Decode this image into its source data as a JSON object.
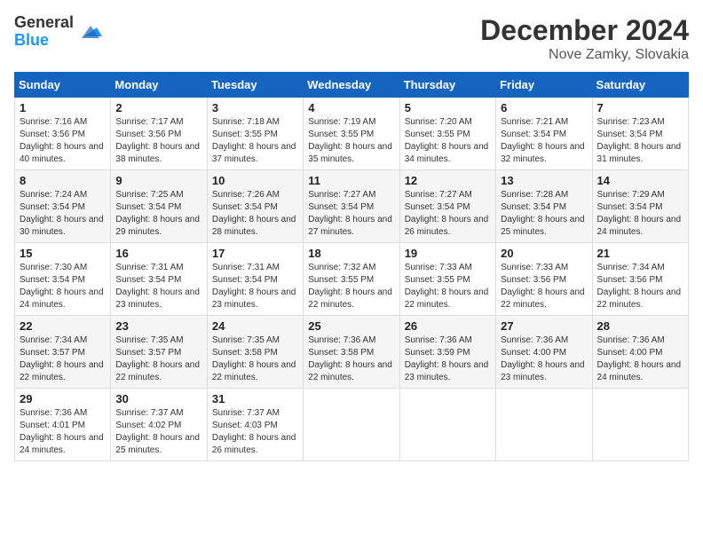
{
  "header": {
    "logo_general": "General",
    "logo_blue": "Blue",
    "month_year": "December 2024",
    "location": "Nove Zamky, Slovakia"
  },
  "days_of_week": [
    "Sunday",
    "Monday",
    "Tuesday",
    "Wednesday",
    "Thursday",
    "Friday",
    "Saturday"
  ],
  "weeks": [
    [
      {
        "day": "1",
        "sunrise": "Sunrise: 7:16 AM",
        "sunset": "Sunset: 3:56 PM",
        "daylight": "Daylight: 8 hours and 40 minutes."
      },
      {
        "day": "2",
        "sunrise": "Sunrise: 7:17 AM",
        "sunset": "Sunset: 3:56 PM",
        "daylight": "Daylight: 8 hours and 38 minutes."
      },
      {
        "day": "3",
        "sunrise": "Sunrise: 7:18 AM",
        "sunset": "Sunset: 3:55 PM",
        "daylight": "Daylight: 8 hours and 37 minutes."
      },
      {
        "day": "4",
        "sunrise": "Sunrise: 7:19 AM",
        "sunset": "Sunset: 3:55 PM",
        "daylight": "Daylight: 8 hours and 35 minutes."
      },
      {
        "day": "5",
        "sunrise": "Sunrise: 7:20 AM",
        "sunset": "Sunset: 3:55 PM",
        "daylight": "Daylight: 8 hours and 34 minutes."
      },
      {
        "day": "6",
        "sunrise": "Sunrise: 7:21 AM",
        "sunset": "Sunset: 3:54 PM",
        "daylight": "Daylight: 8 hours and 32 minutes."
      },
      {
        "day": "7",
        "sunrise": "Sunrise: 7:23 AM",
        "sunset": "Sunset: 3:54 PM",
        "daylight": "Daylight: 8 hours and 31 minutes."
      }
    ],
    [
      {
        "day": "8",
        "sunrise": "Sunrise: 7:24 AM",
        "sunset": "Sunset: 3:54 PM",
        "daylight": "Daylight: 8 hours and 30 minutes."
      },
      {
        "day": "9",
        "sunrise": "Sunrise: 7:25 AM",
        "sunset": "Sunset: 3:54 PM",
        "daylight": "Daylight: 8 hours and 29 minutes."
      },
      {
        "day": "10",
        "sunrise": "Sunrise: 7:26 AM",
        "sunset": "Sunset: 3:54 PM",
        "daylight": "Daylight: 8 hours and 28 minutes."
      },
      {
        "day": "11",
        "sunrise": "Sunrise: 7:27 AM",
        "sunset": "Sunset: 3:54 PM",
        "daylight": "Daylight: 8 hours and 27 minutes."
      },
      {
        "day": "12",
        "sunrise": "Sunrise: 7:27 AM",
        "sunset": "Sunset: 3:54 PM",
        "daylight": "Daylight: 8 hours and 26 minutes."
      },
      {
        "day": "13",
        "sunrise": "Sunrise: 7:28 AM",
        "sunset": "Sunset: 3:54 PM",
        "daylight": "Daylight: 8 hours and 25 minutes."
      },
      {
        "day": "14",
        "sunrise": "Sunrise: 7:29 AM",
        "sunset": "Sunset: 3:54 PM",
        "daylight": "Daylight: 8 hours and 24 minutes."
      }
    ],
    [
      {
        "day": "15",
        "sunrise": "Sunrise: 7:30 AM",
        "sunset": "Sunset: 3:54 PM",
        "daylight": "Daylight: 8 hours and 24 minutes."
      },
      {
        "day": "16",
        "sunrise": "Sunrise: 7:31 AM",
        "sunset": "Sunset: 3:54 PM",
        "daylight": "Daylight: 8 hours and 23 minutes."
      },
      {
        "day": "17",
        "sunrise": "Sunrise: 7:31 AM",
        "sunset": "Sunset: 3:54 PM",
        "daylight": "Daylight: 8 hours and 23 minutes."
      },
      {
        "day": "18",
        "sunrise": "Sunrise: 7:32 AM",
        "sunset": "Sunset: 3:55 PM",
        "daylight": "Daylight: 8 hours and 22 minutes."
      },
      {
        "day": "19",
        "sunrise": "Sunrise: 7:33 AM",
        "sunset": "Sunset: 3:55 PM",
        "daylight": "Daylight: 8 hours and 22 minutes."
      },
      {
        "day": "20",
        "sunrise": "Sunrise: 7:33 AM",
        "sunset": "Sunset: 3:56 PM",
        "daylight": "Daylight: 8 hours and 22 minutes."
      },
      {
        "day": "21",
        "sunrise": "Sunrise: 7:34 AM",
        "sunset": "Sunset: 3:56 PM",
        "daylight": "Daylight: 8 hours and 22 minutes."
      }
    ],
    [
      {
        "day": "22",
        "sunrise": "Sunrise: 7:34 AM",
        "sunset": "Sunset: 3:57 PM",
        "daylight": "Daylight: 8 hours and 22 minutes."
      },
      {
        "day": "23",
        "sunrise": "Sunrise: 7:35 AM",
        "sunset": "Sunset: 3:57 PM",
        "daylight": "Daylight: 8 hours and 22 minutes."
      },
      {
        "day": "24",
        "sunrise": "Sunrise: 7:35 AM",
        "sunset": "Sunset: 3:58 PM",
        "daylight": "Daylight: 8 hours and 22 minutes."
      },
      {
        "day": "25",
        "sunrise": "Sunrise: 7:36 AM",
        "sunset": "Sunset: 3:58 PM",
        "daylight": "Daylight: 8 hours and 22 minutes."
      },
      {
        "day": "26",
        "sunrise": "Sunrise: 7:36 AM",
        "sunset": "Sunset: 3:59 PM",
        "daylight": "Daylight: 8 hours and 23 minutes."
      },
      {
        "day": "27",
        "sunrise": "Sunrise: 7:36 AM",
        "sunset": "Sunset: 4:00 PM",
        "daylight": "Daylight: 8 hours and 23 minutes."
      },
      {
        "day": "28",
        "sunrise": "Sunrise: 7:36 AM",
        "sunset": "Sunset: 4:00 PM",
        "daylight": "Daylight: 8 hours and 24 minutes."
      }
    ],
    [
      {
        "day": "29",
        "sunrise": "Sunrise: 7:36 AM",
        "sunset": "Sunset: 4:01 PM",
        "daylight": "Daylight: 8 hours and 24 minutes."
      },
      {
        "day": "30",
        "sunrise": "Sunrise: 7:37 AM",
        "sunset": "Sunset: 4:02 PM",
        "daylight": "Daylight: 8 hours and 25 minutes."
      },
      {
        "day": "31",
        "sunrise": "Sunrise: 7:37 AM",
        "sunset": "Sunset: 4:03 PM",
        "daylight": "Daylight: 8 hours and 26 minutes."
      },
      null,
      null,
      null,
      null
    ]
  ]
}
